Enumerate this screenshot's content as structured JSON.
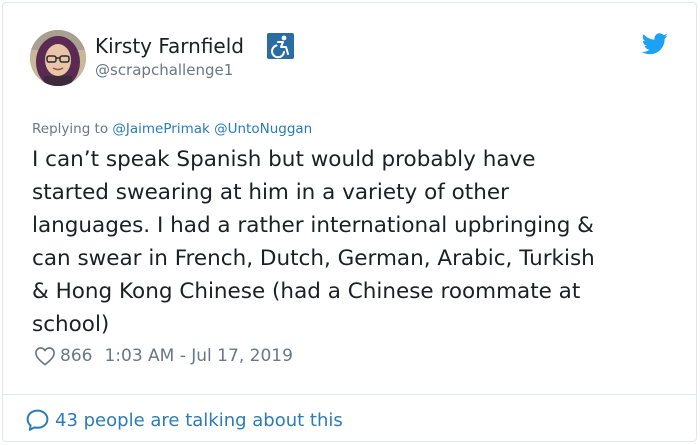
{
  "author": {
    "display_name": "Kirsty Farnfield",
    "handle": "@scrapchallenge1",
    "badge_icon": "accessibility-icon",
    "avatar_icon": "avatar"
  },
  "platform_icon": "twitter-bird-icon",
  "reply": {
    "prefix": "Replying to",
    "mentions": [
      "@JaimePrimak",
      "@UntoNuggan"
    ]
  },
  "tweet": {
    "lines": [
      "I can’t speak Spanish but would probably have",
      "started swearing at him in a variety of other",
      "languages. I had a rather international upbringing &",
      "can swear in French, Dutch, German, Arabic, Turkish",
      "& Hong Kong Chinese (had a Chinese roommate at",
      "school)"
    ]
  },
  "meta": {
    "like_count": "866",
    "timestamp": "1:03 AM - Jul 17, 2019"
  },
  "footer": {
    "talking_text": "43 people are talking about this"
  },
  "colors": {
    "text": "#1c2022",
    "secondary": "#697882",
    "link": "#2b7bb9",
    "twitter_blue": "#1da1f2",
    "border": "#e1e8ed",
    "badge_bg": "#2b6ca3"
  }
}
